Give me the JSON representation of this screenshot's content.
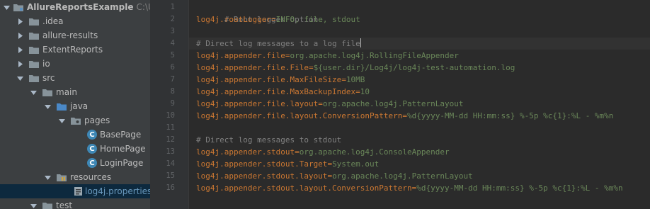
{
  "project_tree": {
    "root": {
      "label": "AllureReportsExample",
      "path": "C:\\Users\\"
    },
    "items": [
      {
        "label": ".idea"
      },
      {
        "label": "allure-results"
      },
      {
        "label": "ExtentReports"
      },
      {
        "label": "io"
      },
      {
        "label": "src"
      },
      {
        "label": "main"
      },
      {
        "label": "java"
      },
      {
        "label": "pages"
      },
      {
        "label": "BasePage"
      },
      {
        "label": "HomePage"
      },
      {
        "label": "LoginPage"
      },
      {
        "label": "resources"
      },
      {
        "label": "log4j.properties"
      },
      {
        "label": "test"
      }
    ],
    "class_icon_letter": "C"
  },
  "editor": {
    "line_numbers": [
      "1",
      "2",
      "3",
      "4",
      "5",
      "6",
      "7",
      "8",
      "9",
      "10",
      "11",
      "12",
      "13",
      "14",
      "15",
      "16"
    ],
    "lines": [
      {
        "comment": "# Root logger option"
      },
      {
        "key": "log4j.rootLogger",
        "eq": "=",
        "value": "INFO, file, stdout"
      },
      {
        "comment": ""
      },
      {
        "comment": "# Direct log messages to a log file"
      },
      {
        "key": "log4j.appender.file",
        "eq": "=",
        "value": "org.apache.log4j.RollingFileAppender"
      },
      {
        "key": "log4j.appender.file.File",
        "eq": "=",
        "value": "${user.dir}/Log4j/log4j-test-automation.log"
      },
      {
        "key": "log4j.appender.file.MaxFileSize",
        "eq": "=",
        "value": "10MB"
      },
      {
        "key": "log4j.appender.file.MaxBackupIndex",
        "eq": "=",
        "value": "10"
      },
      {
        "key": "log4j.appender.file.layout",
        "eq": "=",
        "value": "org.apache.log4j.PatternLayout"
      },
      {
        "key": "log4j.appender.file.layout.ConversionPattern",
        "eq": "=",
        "value": "%d{yyyy-MM-dd HH:mm:ss} %-5p %c{1}:%L - %m%n"
      },
      {
        "comment": ""
      },
      {
        "comment": "# Direct log messages to stdout"
      },
      {
        "key": "log4j.appender.stdout",
        "eq": "=",
        "value": "org.apache.log4j.ConsoleAppender"
      },
      {
        "key": "log4j.appender.stdout.Target",
        "eq": "=",
        "value": "System.out"
      },
      {
        "key": "log4j.appender.stdout.layout",
        "eq": "=",
        "value": "org.apache.log4j.PatternLayout"
      },
      {
        "key": "log4j.appender.stdout.layout.ConversionPattern",
        "eq": "=",
        "value": "%d{yyyy-MM-dd HH:mm:ss} %-5p %c{1}:%L - %m%n"
      }
    ]
  },
  "colors": {
    "tree_bg": "#3c3f41",
    "editor_bg": "#2b2b2b",
    "gutter_bg": "#313335",
    "comment": "#808080",
    "key": "#cc7832",
    "value": "#6a8759",
    "selection": "#0d293e",
    "class_icon": "#3e87b5"
  }
}
